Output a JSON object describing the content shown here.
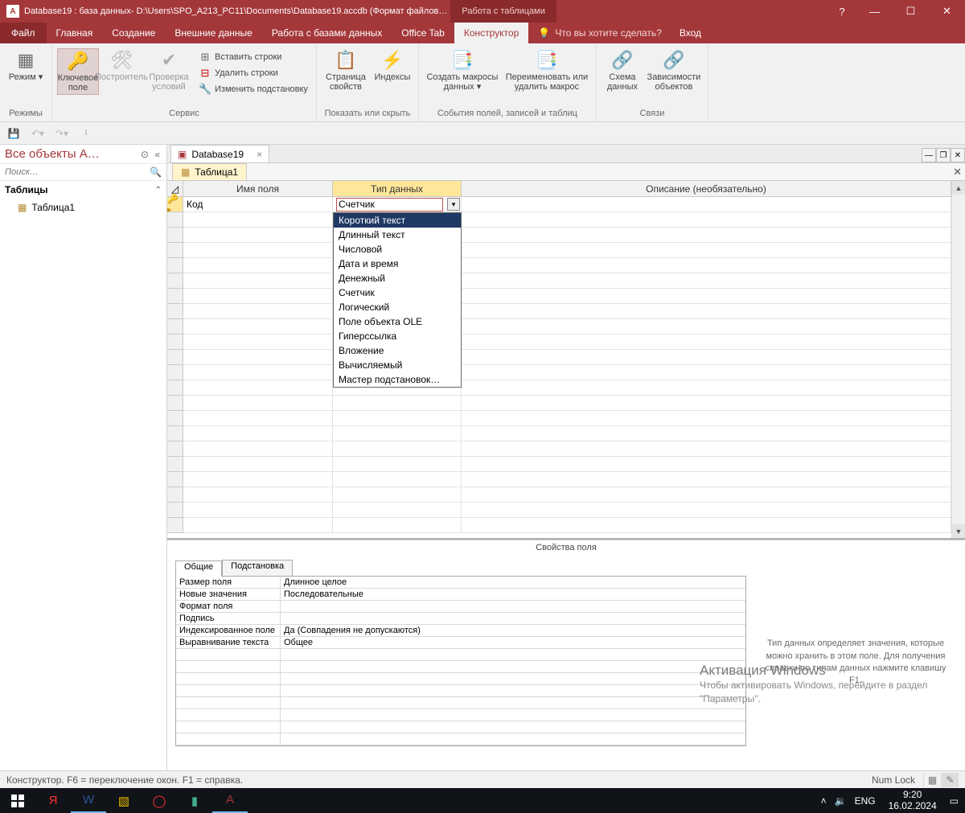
{
  "titlebar": {
    "text": "Database19 : база данных- D:\\Users\\SPO_A213_PC11\\Documents\\Database19.accdb (Формат файлов…",
    "context_tab": "Работа с таблицами"
  },
  "menubar": {
    "file": "Файл",
    "tabs": [
      "Главная",
      "Создание",
      "Внешние данные",
      "Работа с базами данных",
      "Office Tab",
      "Конструктор"
    ],
    "active_index": 5,
    "tell_me": "Что вы хотите сделать?",
    "login": "Вход"
  },
  "ribbon": {
    "groups": [
      {
        "label": "Режимы",
        "big": [
          {
            "icon": "🗔",
            "label": "Режим ▾"
          }
        ]
      },
      {
        "label": "Сервис",
        "big": [
          {
            "icon": "🔑",
            "label": "Ключевое поле",
            "selected": true
          },
          {
            "icon": "📐",
            "label": "Построитель",
            "disabled": true
          },
          {
            "icon": "✔",
            "label": "Проверка условий",
            "disabled": true
          }
        ],
        "small": [
          {
            "icon": "➕",
            "label": "Вставить строки"
          },
          {
            "icon": "✖",
            "label": "Удалить строки"
          },
          {
            "icon": "🔧",
            "label": "Изменить подстановку"
          }
        ]
      },
      {
        "label": "Показать или скрыть",
        "big": [
          {
            "icon": "📄",
            "label": "Страница свойств"
          },
          {
            "icon": "⚡",
            "label": "Индексы"
          }
        ]
      },
      {
        "label": "События полей, записей и таблиц",
        "big": [
          {
            "icon": "📑",
            "label": "Создать макросы данных ▾"
          },
          {
            "icon": "📑",
            "label": "Переименовать или удалить макрос"
          }
        ]
      },
      {
        "label": "Связи",
        "big": [
          {
            "icon": "🔗",
            "label": "Схема данных"
          },
          {
            "icon": "🔗",
            "label": "Зависимости объектов"
          }
        ]
      }
    ]
  },
  "navpane": {
    "title": "Все объекты A…",
    "search_placeholder": "Поиск…",
    "group": "Таблицы",
    "items": [
      {
        "icon": "▦",
        "label": "Таблица1"
      }
    ]
  },
  "doctabs": {
    "tab": "Database19",
    "subtab": "Таблица1"
  },
  "design_grid": {
    "headers": [
      "Имя поля",
      "Тип данных",
      "Описание (необязательно)"
    ],
    "row": {
      "name": "Код",
      "type": "Счетчик"
    },
    "dropdown": [
      "Короткий текст",
      "Длинный текст",
      "Числовой",
      "Дата и время",
      "Денежный",
      "Счетчик",
      "Логический",
      "Поле объекта OLE",
      "Гиперссылка",
      "Вложение",
      "Вычисляемый",
      "Мастер подстановок…"
    ],
    "dropdown_selected": 0
  },
  "field_props": {
    "caption": "Свойства поля",
    "tabs": [
      "Общие",
      "Подстановка"
    ],
    "rows": [
      {
        "k": "Размер поля",
        "v": "Длинное целое"
      },
      {
        "k": "Новые значения",
        "v": "Последовательные"
      },
      {
        "k": "Формат поля",
        "v": ""
      },
      {
        "k": "Подпись",
        "v": ""
      },
      {
        "k": "Индексированное поле",
        "v": "Да (Совпадения не допускаются)"
      },
      {
        "k": "Выравнивание текста",
        "v": "Общее"
      }
    ],
    "help": "Тип данных определяет значения, которые можно хранить в этом поле. Для получения справки по типам данных нажмите клавишу F1."
  },
  "activation": {
    "title": "Активация Windows",
    "text": "Чтобы активировать Windows, перейдите в раздел \"Параметры\"."
  },
  "statusbar": {
    "left": "Конструктор.  F6 = переключение окон.  F1 = справка.",
    "numlock": "Num Lock"
  },
  "taskbar": {
    "lang": "ENG",
    "time": "9:20",
    "date": "16.02.2024"
  }
}
